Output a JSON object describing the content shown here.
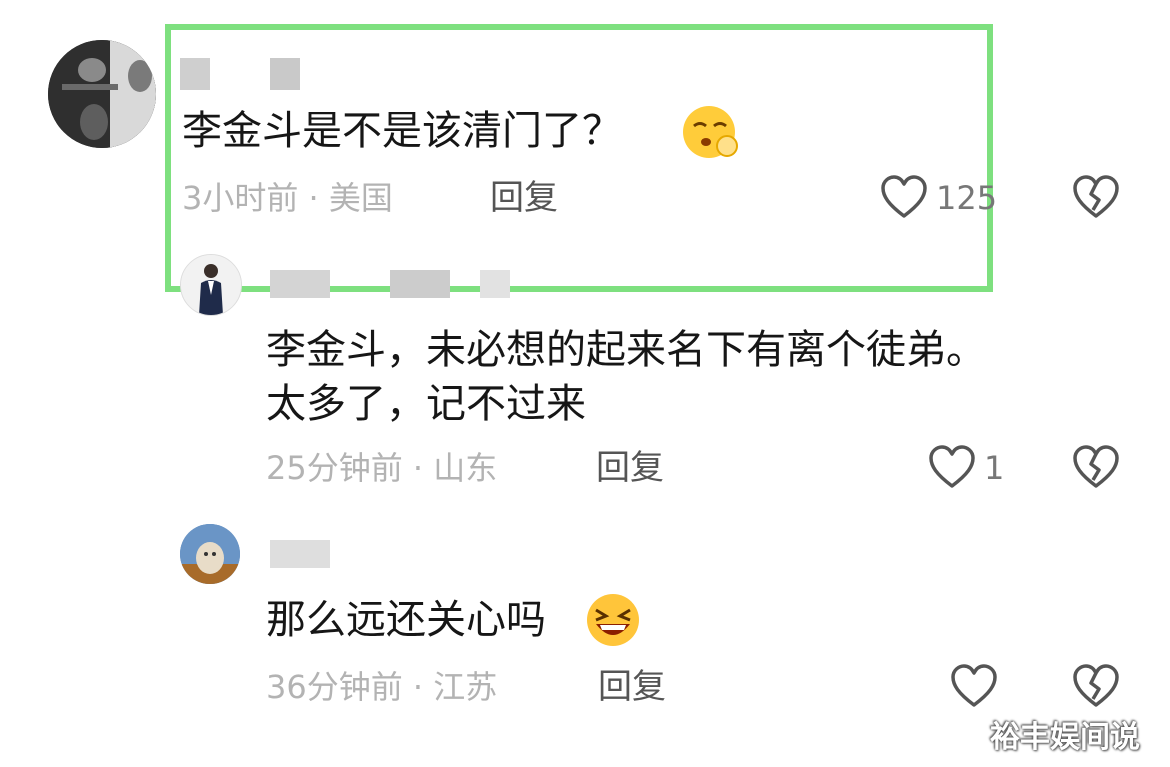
{
  "comments": [
    {
      "text": "李金斗是不是该清门了？",
      "time": "3小时前",
      "location": "美国",
      "reply_label": "回复",
      "likes": "125",
      "avatar_icon": "cat-photo-avatar",
      "emoji_icon": "shushing-face-emoji"
    },
    {
      "text_line1": "李金斗，未必想的起来名下有离个徒弟。",
      "text_line2": "太多了，记不过来",
      "time": "25分钟前",
      "location": "山东",
      "reply_label": "回复",
      "likes": "1",
      "avatar_icon": "man-in-suit-avatar"
    },
    {
      "text": "那么远还关心吗",
      "time": "36分钟前",
      "location": "江苏",
      "reply_label": "回复",
      "likes": "",
      "avatar_icon": "cat-photo-avatar",
      "emoji_icon": "laughing-face-emoji"
    }
  ],
  "meta_separator": "·",
  "watermark": "裕丰娱间说",
  "colors": {
    "highlight_border": "#7ee07f",
    "meta_text": "#b3b3b3",
    "reply_text": "#555555",
    "comment_text": "#161616"
  }
}
